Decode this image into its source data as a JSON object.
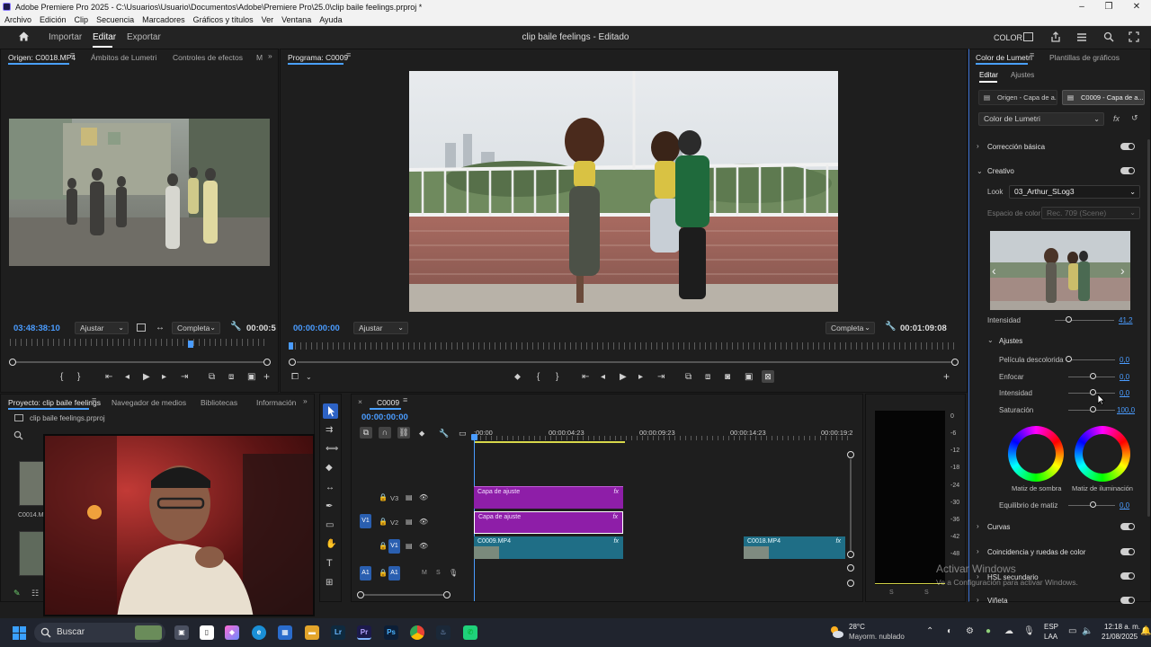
{
  "window": {
    "title": "Adobe Premiere Pro 2025 - C:\\Usuarios\\Usuario\\Documentos\\Adobe\\Premiere Pro\\25.0\\clip baile feelings.prproj *"
  },
  "menu": [
    "Archivo",
    "Edición",
    "Clip",
    "Secuencia",
    "Marcadores",
    "Gráficos y títulos",
    "Ver",
    "Ventana",
    "Ayuda"
  ],
  "header": {
    "nav": [
      "Importar",
      "Editar",
      "Exportar"
    ],
    "project_title": "clip baile feelings - Editado",
    "right_label": "COLOR"
  },
  "source_monitor": {
    "tabs": [
      "Origen: C0018.MP4",
      "Ámbitos de Lumetri",
      "Controles de efectos",
      "M"
    ],
    "timecode": "03:48:38:10",
    "fit": "Ajustar",
    "quality": "Completa",
    "duration": "00:00:5"
  },
  "program_monitor": {
    "tab": "Programa: C0009",
    "timecode": "00:00:00:00",
    "fit": "Ajustar",
    "quality": "Completa",
    "duration": "00:01:09:08"
  },
  "project_panel": {
    "tabs": [
      "Proyecto: clip baile feelings",
      "Navegador de medios",
      "Bibliotecas",
      "Información"
    ],
    "file": "clip baile feelings.prproj",
    "items": [
      "C0014.M"
    ]
  },
  "timeline": {
    "tab": "C0009",
    "timecode": "00:00:00:00",
    "ruler": [
      ":00:00",
      "00:00:04:23",
      "00:00:09:23",
      "00:00:14:23",
      "00:00:19:2"
    ],
    "tracks": {
      "v3": "V3",
      "v2": "V2",
      "v1": "V1",
      "a1": "A1",
      "src_v1": "V1",
      "src_a1": "A1"
    },
    "clips": {
      "adj1": "Capa de ajuste",
      "adj2": "Capa de ajuste",
      "c9": "C0009.MP4",
      "c18": "C0018.MP4",
      "fx": "fx"
    }
  },
  "meter": {
    "scale": [
      "0",
      "-6",
      "-12",
      "-18",
      "-24",
      "-30",
      "-36",
      "-42",
      "-48"
    ],
    "bottom": [
      "S",
      "S"
    ]
  },
  "lumetri": {
    "tabs": [
      "Color de Lumetri",
      "Plantillas de gráficos"
    ],
    "subtabs": [
      "Editar",
      "Ajustes"
    ],
    "source_btn": "Origen - Capa de a...",
    "seq_btn": "C0009 - Capa de a...",
    "effect": "Color de Lumetri",
    "sections": {
      "basic": "Corrección básica",
      "creative": "Creativo",
      "ajustes": "Ajustes",
      "curves": "Curvas",
      "match": "Coincidencia y ruedas de color",
      "hsl": "HSL secundario",
      "vignette": "Viñeta"
    },
    "look_label": "Look",
    "look_value": "03_Arthur_SLog3",
    "color_space_label": "Espacio de color",
    "color_space_value": "Rec. 709 (Scene)",
    "intensity_label": "Intensidad",
    "intensity_value": "41,2",
    "sliders": [
      {
        "label": "Película descolorida",
        "value": "0,0"
      },
      {
        "label": "Enfocar",
        "value": "0,0"
      },
      {
        "label": "Intensidad",
        "value": "0,0"
      },
      {
        "label": "Saturación",
        "value": "100,0"
      }
    ],
    "wheel_shadow": "Matiz de sombra",
    "wheel_highlight": "Matiz de iluminación",
    "balance_label": "Equilibrio de matiz",
    "balance_value": "0,0"
  },
  "watermark": {
    "line1": "Activar Windows",
    "line2": "Ve a Configuración para activar Windows."
  },
  "taskbar": {
    "search": "Buscar",
    "weather_temp": "28°C",
    "weather_desc": "Mayorm. nublado",
    "lang1": "ESP",
    "lang2": "LAA",
    "time": "12:18 a. m.",
    "date": "21/08/2025",
    "apps": [
      "Lr",
      "Pr",
      "Ps"
    ]
  }
}
